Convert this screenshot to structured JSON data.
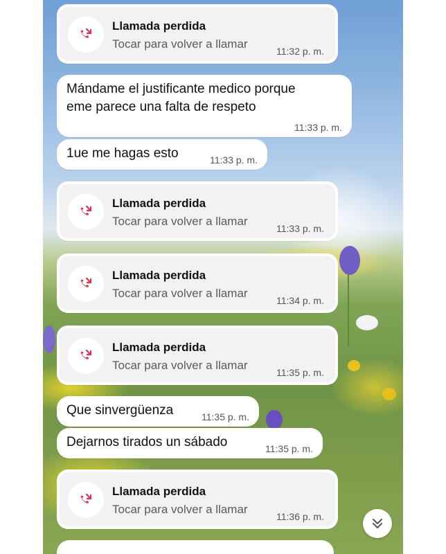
{
  "missed_call": {
    "title": "Llamada perdida",
    "subtitle": "Tocar para volver a llamar"
  },
  "messages": [
    {
      "type": "call",
      "time": "11:32 p. m."
    },
    {
      "type": "text",
      "lines": [
        "Mándame el justificante medico porque",
        "eme parece una falta de respeto"
      ],
      "time": "11:33 p. m."
    },
    {
      "type": "text",
      "lines": [
        "1ue me hagas esto"
      ],
      "time": "11:33 p. m."
    },
    {
      "type": "call",
      "time": "11:33 p. m."
    },
    {
      "type": "call",
      "time": "11:34 p. m."
    },
    {
      "type": "call",
      "time": "11:35 p. m."
    },
    {
      "type": "text",
      "lines": [
        "Que sinvergüenza"
      ],
      "time": "11:35 p. m."
    },
    {
      "type": "text",
      "lines": [
        "Dejarnos tirados un sábado"
      ],
      "time": "11:35 p. m."
    },
    {
      "type": "call",
      "time": "11:36 p. m."
    }
  ],
  "icons": {
    "missed_call": "missed-call-icon",
    "scroll_down": "double-chevron-down-icon"
  },
  "colors": {
    "missed_call_icon": "#d8334a",
    "bubble": "#ffffff",
    "call_card": "#f2f2f2"
  }
}
